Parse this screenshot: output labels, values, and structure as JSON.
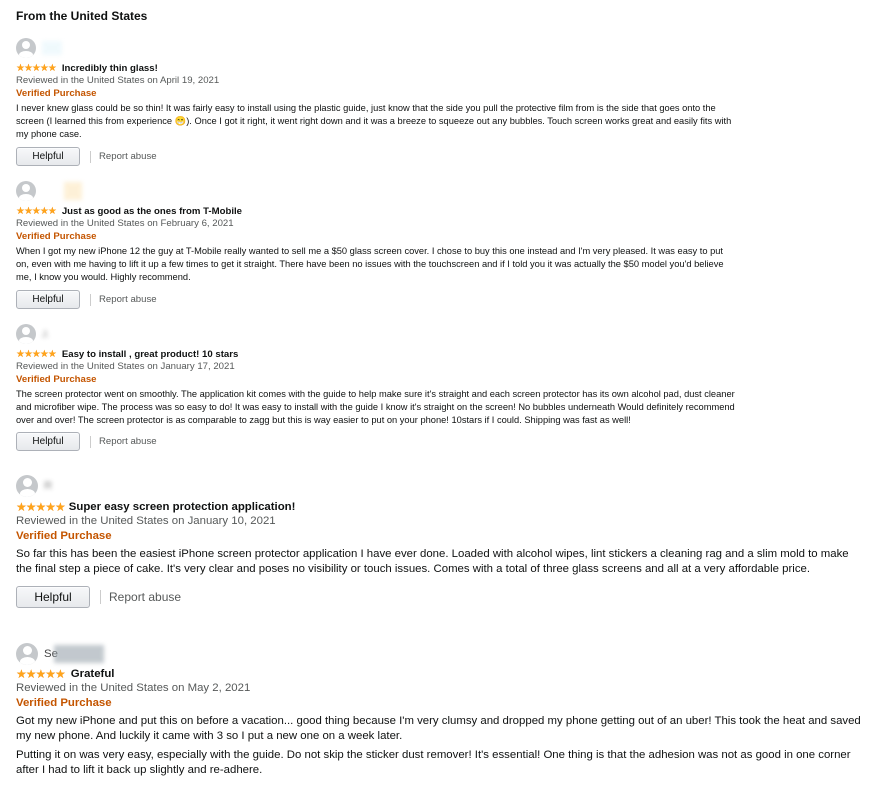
{
  "heading": "From the United States",
  "helpful_label": "Helpful",
  "report_label": "Report abuse",
  "verified_label": "Verified Purchase",
  "stars": "★★★★★",
  "reviews": [
    {
      "profile": "",
      "title": "Incredibly thin glass!",
      "meta": "Reviewed in the United States on April 19, 2021",
      "body": "I never knew glass could be so thin! It was fairly easy to install using the plastic guide, just know that the side you pull the protective film from is the side that goes onto the screen (I learned this from experience 😁). Once I got it right, it went right down and it was a breeze to squeeze out any bubbles. Touch screen works great and easily fits with my phone case."
    },
    {
      "profile": "",
      "title": "Just as good as the ones from T-Mobile",
      "meta": "Reviewed in the United States on February 6, 2021",
      "body": "When I got my new iPhone 12 the guy at T-Mobile really wanted to sell me a $50 glass screen cover. I chose to buy this one instead and I'm very pleased. It was easy to put on, even with me having to lift it up a few times to get it straight. There have been no issues with the touchscreen and if I told you it was actually the $50 model you'd believe me, I know you would. Highly recommend."
    },
    {
      "profile": "J.",
      "title": "Easy to install , great product! 10 stars",
      "meta": "Reviewed in the United States on January 17, 2021",
      "body": "The screen protector went on smoothly. The application kit comes with the guide to help make sure it's straight and each screen protector has its own alcohol pad, dust cleaner and microfiber wipe. The process was so easy to do! It was easy to install with the guide I know it's straight on the screen! No bubbles underneath Would definitely recommend over and over! The screen protector is as comparable to zagg but this is way easier to put on your phone! 10stars if I could. Shipping was fast as well!"
    },
    {
      "profile": "R",
      "title": "Super easy screen protection application!",
      "meta": "Reviewed in the United States on January 10, 2021",
      "body": "So far this has been the easiest iPhone screen protector application I have ever done. Loaded with alcohol wipes, lint stickers a cleaning rag and a slim mold to make the final step a piece of cake. It's very clear and poses no visibility or touch issues. Comes with a total of three glass screens and all at a very affordable price."
    },
    {
      "profile": "Se",
      "title": "Grateful",
      "meta": "Reviewed in the United States on May 2, 2021",
      "body": "Got my new iPhone and put this on before a vacation... good thing because I'm very clumsy and dropped my phone getting out of an uber! This took the heat and saved my new phone. And luckily it came with 3 so I put a new one on a week later.",
      "body2": "Putting it on was very easy, especially with the guide. Do not skip the sticker dust remover! It's essential! One thing is that the adhesion was not as good in one corner after I had to lift it back up slightly and re-adhere."
    }
  ]
}
